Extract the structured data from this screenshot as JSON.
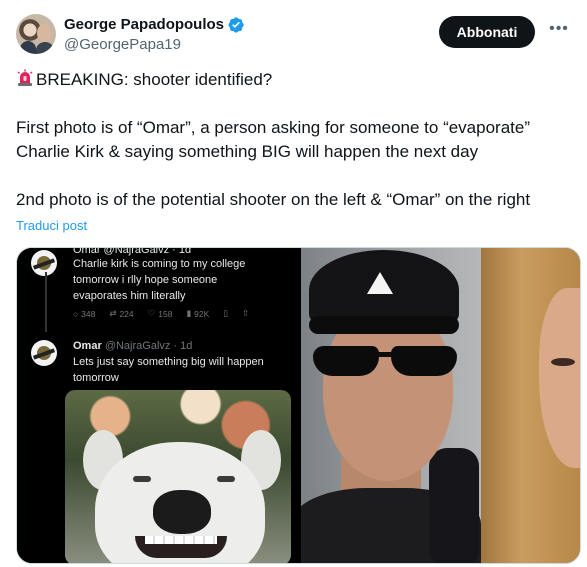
{
  "author": {
    "display_name": "George Papadopoulos",
    "handle": "@GeorgePapa19",
    "verified": true,
    "verified_color": "#1d9bf0"
  },
  "actions": {
    "follow_label": "Abbonati",
    "more_icon": "more-horizontal-icon"
  },
  "post": {
    "lines": [
      "BREAKING: shooter identified?",
      "First photo is of “Omar”, a person asking for someone to “evaporate”",
      "Charlie Kirk & saying something BIG will happen the next day",
      "2nd photo is of the potential shooter on the left & “Omar” on the right"
    ],
    "leading_icon": "siren-emoji-icon",
    "translate_label": "Traduci post",
    "accent_color": "#1d9bf0"
  },
  "media": {
    "screenshot": {
      "first_tweet": {
        "header_partial": "Omar @NajraGalvz · 1d",
        "body": [
          "Charlie kirk is coming to my college",
          "tomorrow i rlly hope someone",
          "evaporates him literally"
        ],
        "stats": {
          "replies": "348",
          "reposts": "224",
          "likes": "158",
          "views": "92K"
        }
      },
      "second_tweet": {
        "name": "Omar",
        "handle_time": "@NajraGalvz · 1d",
        "body": [
          "Lets just say something big will happen",
          "tomorrow"
        ]
      }
    }
  }
}
